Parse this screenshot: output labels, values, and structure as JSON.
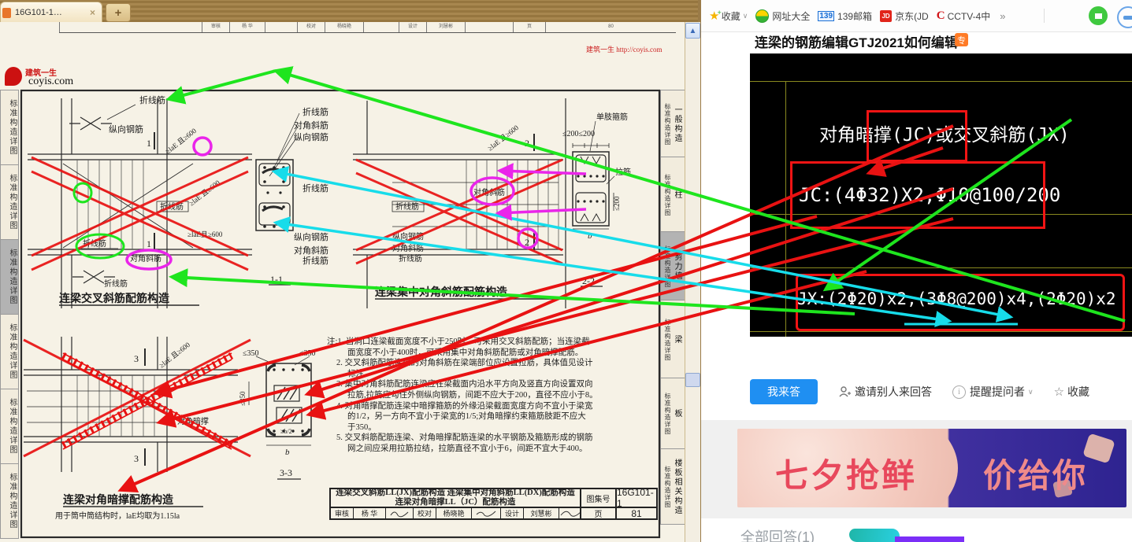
{
  "left_browser": {
    "tab": {
      "title": "16G101-1…",
      "close": "×",
      "new_tab": "+"
    },
    "top_strip_cells": [
      "审核",
      "杨 华",
      "校对",
      "杨晓艳",
      "设计",
      "刘慧彬",
      "页",
      "80"
    ],
    "watermark": "建筑一生 http://coyis.com",
    "logo": {
      "name": "建筑一生",
      "domain": "coyis.com"
    },
    "scroll_up_icon": "▲"
  },
  "sidebar_left": {
    "label": "标准构造详图"
  },
  "sidebar_right": {
    "label": "标准构造详图",
    "tabs": [
      "一般构造",
      "柱",
      "剪力墙",
      "梁",
      "板",
      "楼板相关构造"
    ],
    "active_tab": "剪力墙"
  },
  "drawing": {
    "d1": {
      "zigzag_top": "折线筋",
      "longitudinal": "纵向钢筋",
      "mark": "1",
      "dim_diag": "≥laE 且≥600",
      "dim_horiz": "≥laE且≥600",
      "zigzag_mid": "折线筋",
      "zigzag_circled": "折线筋",
      "diagonal_circled": "对角斜筋",
      "zigzag_bottom": "折线筋",
      "title": "连梁交叉斜筋配筋构造"
    },
    "s11": {
      "top1": "折线筋",
      "top2": "对角斜筋",
      "top3": "纵向钢筋",
      "mid": "折线筋",
      "bot1": "纵向钢筋",
      "bot2": "对角斜筋",
      "bot3": "折线筋",
      "caption": "1-1"
    },
    "d2": {
      "mark": "2",
      "dim_diag": "≥laE 且≥600",
      "zigzag_mid": "折线筋",
      "bot1": "纵向钢筋",
      "bot2": "对角斜筋",
      "bot3": "折线筋",
      "diagonal_circled": "对角斜筋",
      "title": "连梁集中对角斜筋配筋构造"
    },
    "s22": {
      "hoop": "单肢箍筋",
      "dim_top": "≤200≤200",
      "tie": "拉筋",
      "dim_side": "≤200",
      "width": "b",
      "caption": "2-2"
    },
    "d3": {
      "mark": "3",
      "dim_diag": "≥laE 且≥600",
      "brace": "对角暗撑",
      "title": "连梁对角暗撑配筋构造",
      "subtitle": "用于筒中筒结构时，laE均取为1.15la"
    },
    "s33": {
      "dim_top1": "≤350",
      "dim_top2": "≤350",
      "dim_side": "≤350",
      "dim_inner": "≥b/2",
      "width": "b",
      "caption": "3-3"
    },
    "notes": [
      "注:1. 当洞口连梁截面宽度不小于250时，可采用交叉斜筋配筋；当连梁截",
      "面宽度不小于400时，可采用集中对角斜筋配筋或对角暗撑配筋。",
      "2. 交叉斜筋配筋连梁的对角斜筋在梁端部位应设置拉筋，具体值见设计",
      "标注。",
      "3. 集中对角斜筋配筋连梁应在梁截面内沿水平方向及竖直方向设置双向",
      "拉筋,拉筋应勾住外侧纵向钢筋，间距不应大于200，直径不应小于8。",
      "4. 对角暗撑配筋连梁中暗撑箍筋的外缘沿梁截面宽度方向不宜小于梁宽",
      "的1/2，另一方向不宜小于梁宽的1/5;对角暗撑约束箍筋肢距不应大",
      "于350。",
      "5. 交叉斜筋配筋连梁、对角暗撑配筋连梁的水平钢筋及箍筋形成的钢筋",
      "网之间应采用拉筋拉结，拉筋直径不宜小于6，间距不宜大于400。"
    ],
    "title_block": {
      "title_line1": "连梁交叉斜筋LL(JX)配筋构造  连梁集中对角斜筋LL(DX)配筋构造",
      "title_line2": "连梁对角暗撑LL（JC）配筋构造",
      "fig_no_label": "图集号",
      "fig_no": "16G101-1",
      "page_label": "页",
      "page_no": "81",
      "row2": [
        "审核",
        "杨 华",
        "校对",
        "杨晓艳",
        "设计",
        "刘慧彬"
      ]
    }
  },
  "right_page": {
    "bookmarks": {
      "favorites": "收藏",
      "nav": "网址大全",
      "mail": "139邮箱",
      "mail_icon": "139",
      "jd": "京东(JD",
      "jd_icon": "JD",
      "cctv": "CCTV-4中",
      "cctv_icon": "C",
      "more": "»"
    },
    "question": {
      "title": "连梁的钢筋编辑GTJ2021如何编辑",
      "badge": "专"
    },
    "cad": {
      "line1": "对角暗撑(JC)或交叉斜筋(JX)",
      "line2": "JC:(4Φ32)X2,Φ10@100/200",
      "line3": "JX:(2Φ20)x2,(3Φ8@200)x4,(2Φ20)x2"
    },
    "actions": {
      "answer": "我来答",
      "invite": "邀请别人来回答",
      "remind": "提醒提问者",
      "favorite": "收藏"
    },
    "ad": {
      "left": "七夕抢鲜",
      "right": "价给你"
    },
    "answers_header": "全部回答(1)"
  },
  "colors": {
    "annotation_green": "#1ee51e",
    "annotation_red": "#e81212",
    "annotation_cyan": "#17dcea",
    "annotation_magenta": "#ea25ea",
    "cad_box_red": "#f21414",
    "answer_button_blue": "#1f8ff2",
    "badge_orange": "#ff7b26",
    "browser_tan": "#a8874f"
  }
}
